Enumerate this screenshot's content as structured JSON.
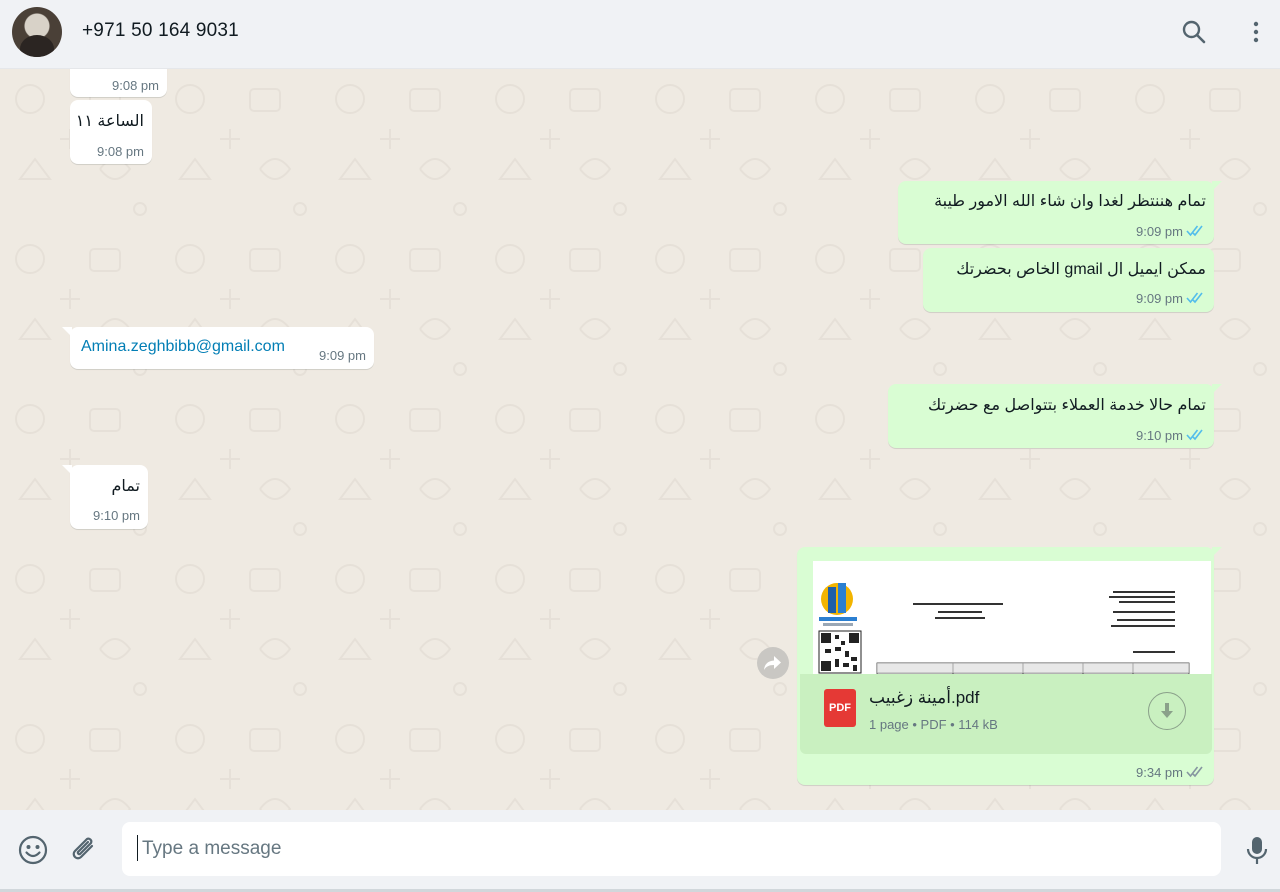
{
  "header": {
    "contact_name": "+971 50 164 9031",
    "icons": [
      "avatar",
      "search-icon",
      "menu-dots-icon"
    ]
  },
  "messages": [
    {
      "direction": "in",
      "text": "",
      "time": "9:08 pm"
    },
    {
      "direction": "in",
      "text": "الساعة ١١",
      "time": "9:08 pm"
    },
    {
      "direction": "out",
      "text": "تمام هننتظر لغدا وان شاء الله الامور طيبة",
      "time": "9:09 pm",
      "status": "read"
    },
    {
      "direction": "out",
      "text": "ممكن ايميل ال gmail الخاص بحضرتك",
      "time": "9:09 pm",
      "status": "read"
    },
    {
      "direction": "in",
      "text": "Amina.zeghbibb@gmail.com",
      "time": "9:09 pm",
      "is_link": true
    },
    {
      "direction": "out",
      "text": "تمام حالا خدمة العملاء بتتواصل مع حضرتك",
      "time": "9:10 pm",
      "status": "read"
    },
    {
      "direction": "in",
      "text": "تمام",
      "time": "9:10 pm"
    },
    {
      "direction": "out",
      "type": "document",
      "file_name": "أمينة زغبيب.pdf",
      "file_meta": "1 page • PDF • 114 kB",
      "file_badge": "PDF",
      "time": "9:34 pm",
      "status": "delivered"
    }
  ],
  "composer": {
    "placeholder": "Type a message",
    "icons": [
      "emoji-icon",
      "attach-icon",
      "mic-icon"
    ]
  },
  "colors": {
    "incoming_bubble": "#ffffff",
    "outgoing_bubble": "#d9fdd3",
    "read_ticks": "#53bdeb",
    "delivered_ticks": "#8696a0",
    "link": "#027eb5",
    "chat_background": "#efeae2"
  }
}
